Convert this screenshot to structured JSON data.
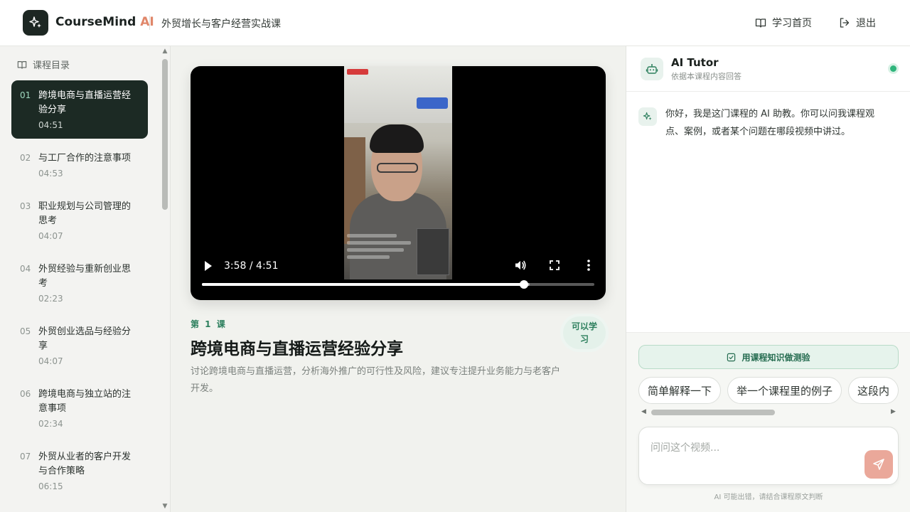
{
  "header": {
    "brand_name": "CourseMind",
    "brand_ai": "AI",
    "course_title": "外贸增长与客户经营实战课",
    "home_label": "学习首页",
    "logout_label": "退出"
  },
  "sidebar": {
    "heading": "课程目录",
    "items": [
      {
        "num": "01",
        "title": "跨境电商与直播运营经验分享",
        "duration": "04:51",
        "active": true
      },
      {
        "num": "02",
        "title": "与工厂合作的注意事项",
        "duration": "04:53"
      },
      {
        "num": "03",
        "title": "职业规划与公司管理的思考",
        "duration": "04:07"
      },
      {
        "num": "04",
        "title": "外贸经验与重新创业思考",
        "duration": "02:23"
      },
      {
        "num": "05",
        "title": "外贸创业选品与经验分享",
        "duration": "04:07"
      },
      {
        "num": "06",
        "title": "跨境电商与独立站的注意事项",
        "duration": "02:34"
      },
      {
        "num": "07",
        "title": "外贸从业者的客户开发与合作策略",
        "duration": "06:15"
      }
    ]
  },
  "player": {
    "time": "3:58 / 4:51",
    "progress": 0.82,
    "buffered": 0.835
  },
  "lesson": {
    "label": "第 1 课",
    "title": "跨境电商与直播运营经验分享",
    "description": "讨论跨境电商与直播运营，分析海外推广的可行性及风险，建议专注提升业务能力与老客户开发。",
    "status_badge": "可以学习"
  },
  "tutor": {
    "name": "AI Tutor",
    "subtitle": "依据本课程内容回答",
    "greeting": "你好，我是这门课程的 AI 助教。你可以问我课程观点、案例，或者某个问题在哪段视频中讲过。",
    "quiz_label": "用课程知识做测验",
    "chips": [
      "简单解释一下",
      "举一个课程里的例子",
      "这段内"
    ],
    "input_placeholder": "问问这个视频...",
    "disclaimer": "AI 可能出错，请结合课程原文判断"
  },
  "colors": {
    "accent_green": "#2c7f5d",
    "brand_ai": "#e0876a",
    "active_item_bg": "#1c2a24",
    "send_button": "#eaa89a",
    "status_online": "#2fb57c"
  }
}
